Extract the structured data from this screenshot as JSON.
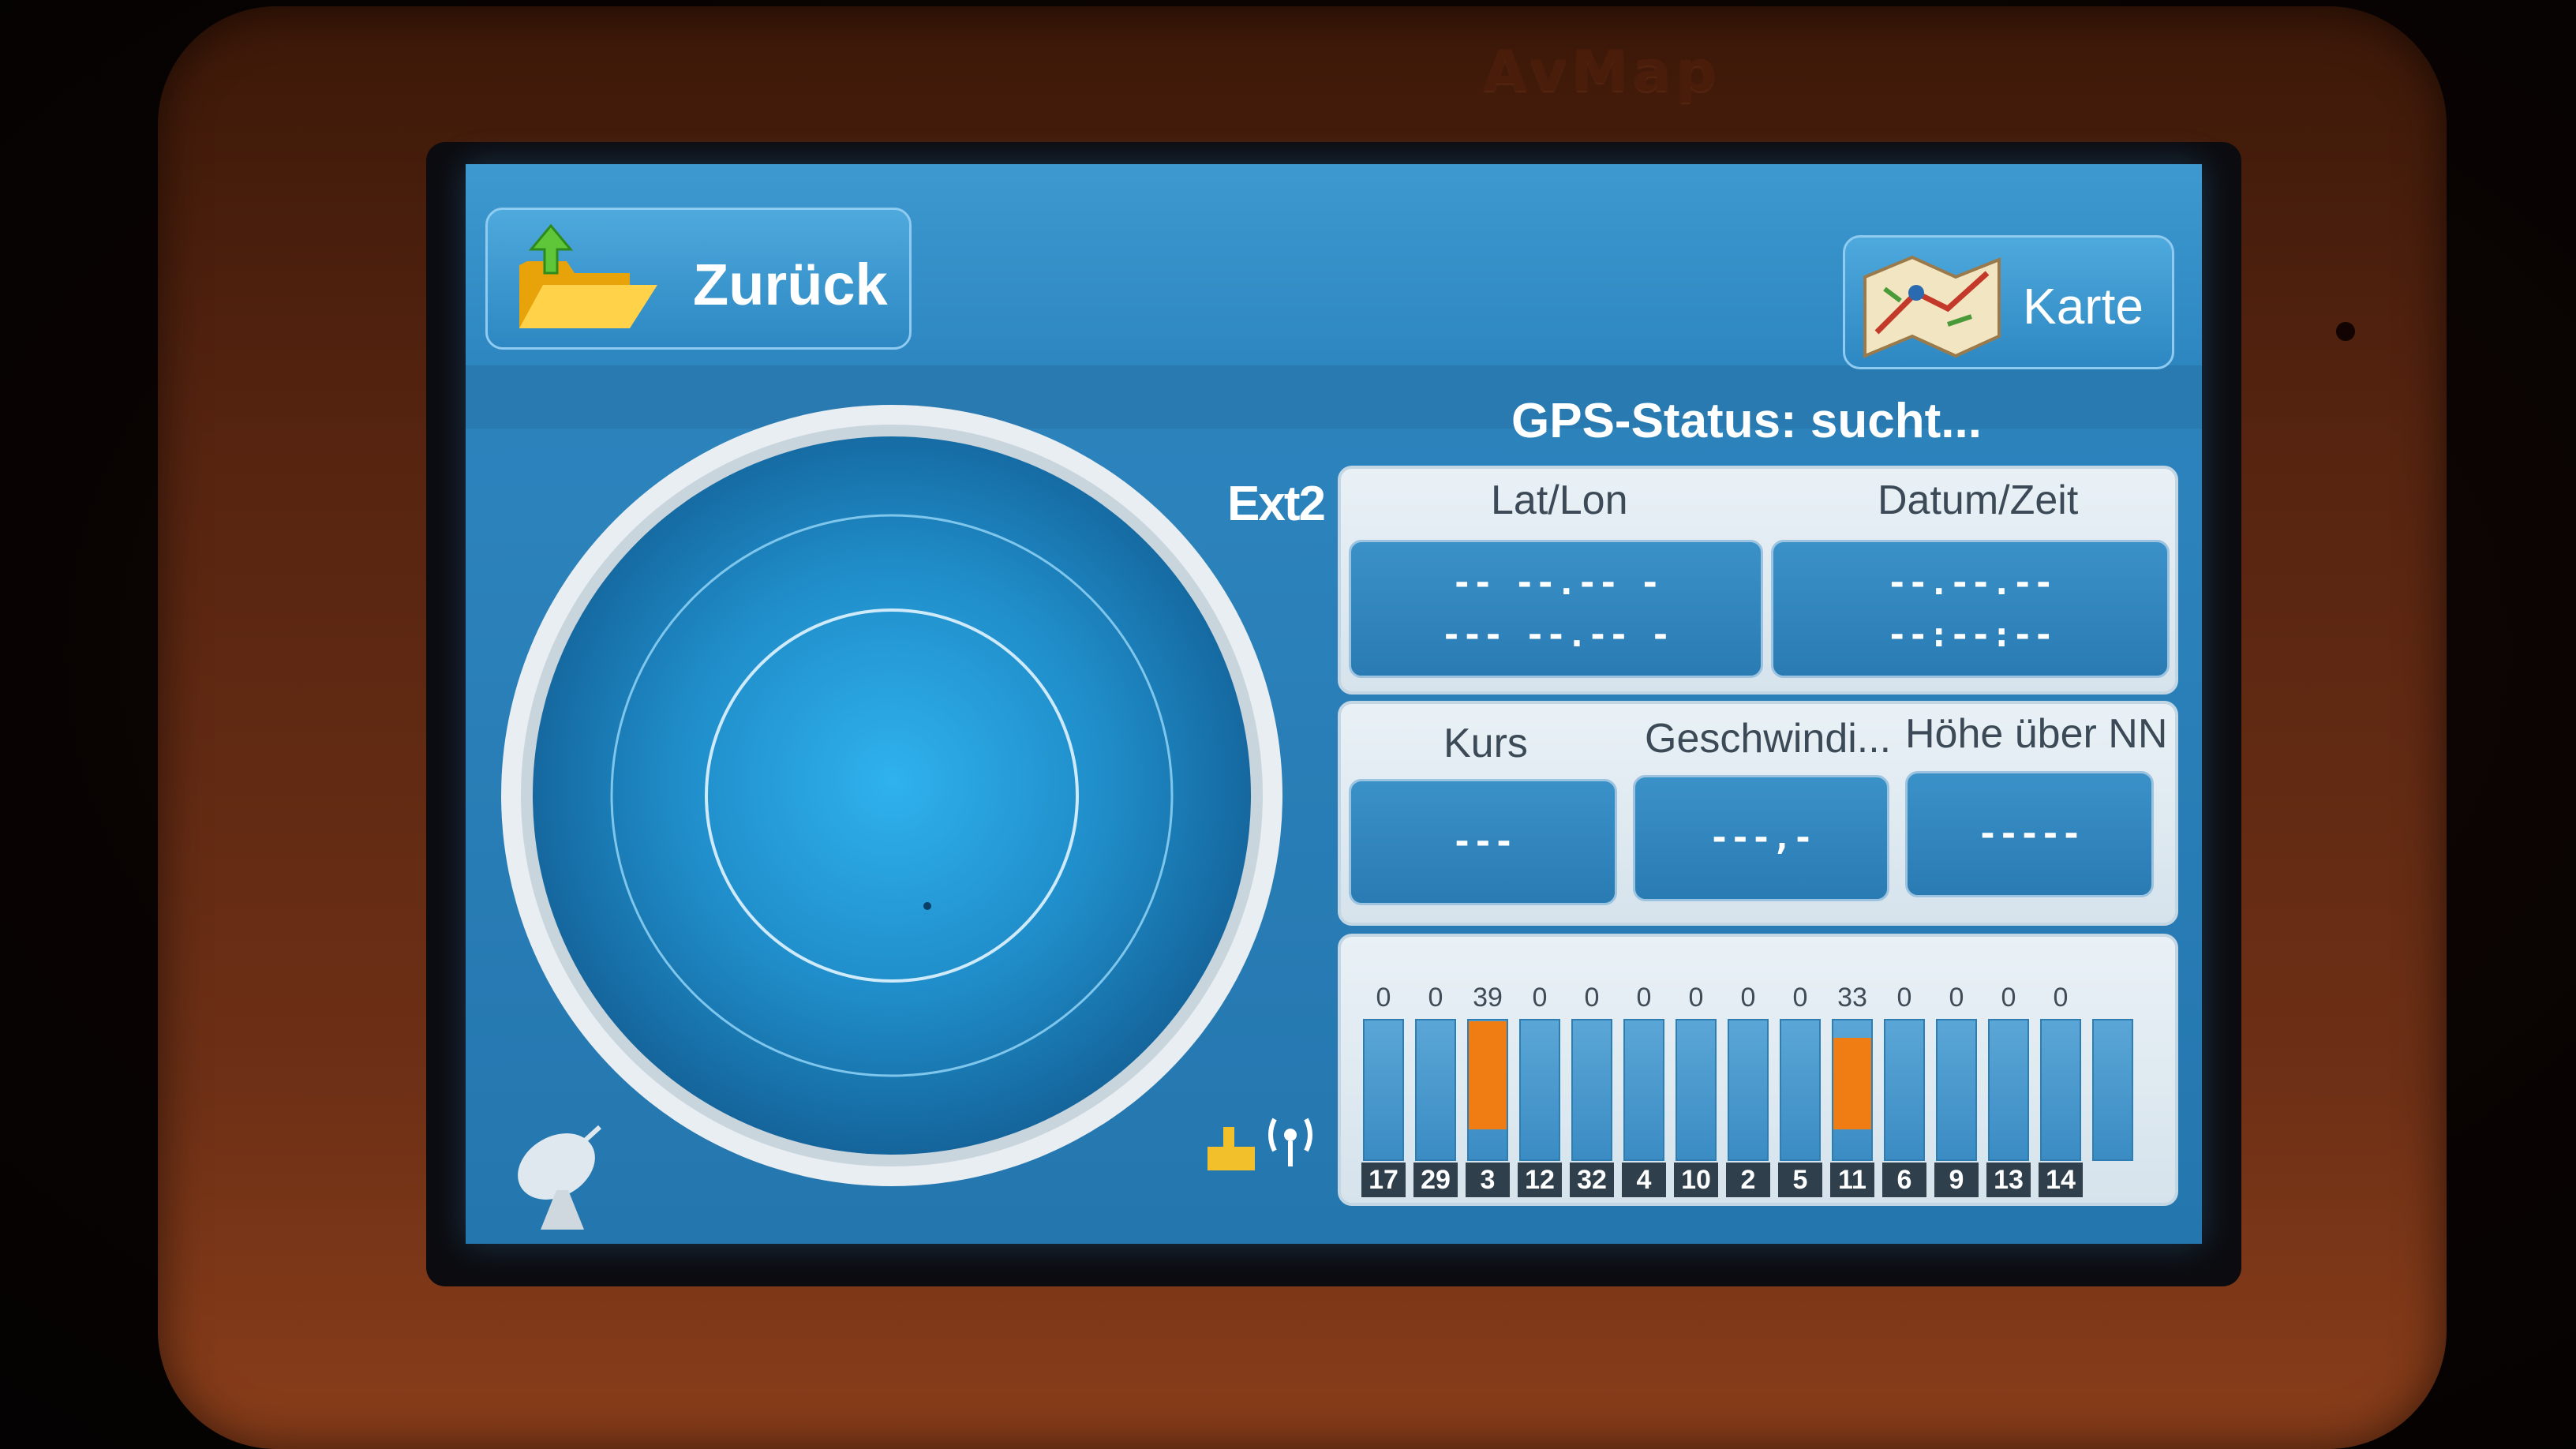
{
  "device": {
    "brand": "AvMap"
  },
  "header": {
    "back_label": "Zurück",
    "map_label": "Karte",
    "gps_status": "GPS-Status: sucht..."
  },
  "radar": {
    "source_label": "Ext2"
  },
  "position_panel": {
    "latlon_title": "Lat/Lon",
    "datetime_title": "Datum/Zeit",
    "lat": "-- --.-- -",
    "lon": "--- --.-- -",
    "date": "--.--.--",
    "time": "--:--:--"
  },
  "motion_panel": {
    "course_title": "Kurs",
    "speed_title": "Geschwindi...",
    "altitude_title": "Höhe über NN",
    "course": "---",
    "speed": "---,-",
    "altitude": "-----"
  },
  "satellites": [
    {
      "prn": "17",
      "snr": "0",
      "level": 0
    },
    {
      "prn": "29",
      "snr": "0",
      "level": 0
    },
    {
      "prn": "3",
      "snr": "39",
      "level": 0.78
    },
    {
      "prn": "12",
      "snr": "0",
      "level": 0
    },
    {
      "prn": "32",
      "snr": "0",
      "level": 0
    },
    {
      "prn": "4",
      "snr": "0",
      "level": 0
    },
    {
      "prn": "10",
      "snr": "0",
      "level": 0
    },
    {
      "prn": "2",
      "snr": "0",
      "level": 0
    },
    {
      "prn": "5",
      "snr": "0",
      "level": 0
    },
    {
      "prn": "11",
      "snr": "33",
      "level": 0.66
    },
    {
      "prn": "6",
      "snr": "0",
      "level": 0
    },
    {
      "prn": "9",
      "snr": "0",
      "level": 0
    },
    {
      "prn": "13",
      "snr": "0",
      "level": 0
    },
    {
      "prn": "14",
      "snr": "0",
      "level": 0
    },
    {
      "prn": "",
      "snr": "",
      "level": 0
    }
  ],
  "colors": {
    "accent": "#2f87c0",
    "signal_fill": "#f07d14",
    "bezel": "#6e3016"
  },
  "icons": [
    "folder-up-icon",
    "map-icon",
    "satellite-dish-icon",
    "gps-antenna-icon"
  ]
}
